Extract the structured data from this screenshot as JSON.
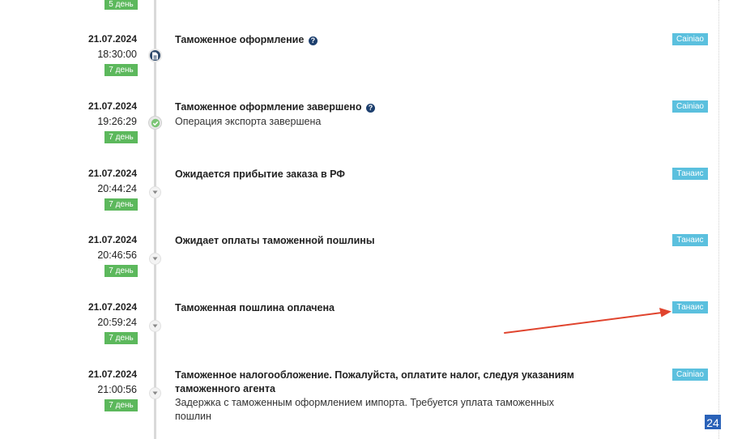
{
  "top_day_badge": "5 день",
  "events": [
    {
      "date": "21.07.2024",
      "time": "18:30:00",
      "day": "7 день",
      "title": "Таможенное оформление",
      "help": true,
      "desc": "",
      "source": "Cainiao",
      "marker": "document-icon"
    },
    {
      "date": "21.07.2024",
      "time": "19:26:29",
      "day": "7 день",
      "title": "Таможенное оформление завершено",
      "help": true,
      "desc": "Операция экспорта завершена",
      "source": "Cainiao",
      "marker": "check-icon"
    },
    {
      "date": "21.07.2024",
      "time": "20:44:24",
      "day": "7 день",
      "title": "Ожидается прибытие заказа в РФ",
      "help": false,
      "desc": "",
      "source": "Танаис",
      "marker": "chevron-down-icon"
    },
    {
      "date": "21.07.2024",
      "time": "20:46:56",
      "day": "7 день",
      "title": "Ожидает оплаты таможенной пошлины",
      "help": false,
      "desc": "",
      "source": "Танаис",
      "marker": "chevron-down-icon"
    },
    {
      "date": "21.07.2024",
      "time": "20:59:24",
      "day": "7 день",
      "title": "Таможенная пошлина оплачена",
      "help": false,
      "desc": "",
      "source": "Танаис",
      "marker": "chevron-down-icon"
    },
    {
      "date": "21.07.2024",
      "time": "21:00:56",
      "day": "7 день",
      "title": "Таможенное налогообложение. Пожалуйста, оплатите налог, следуя указаниям таможенного агента",
      "help": false,
      "desc": "Задержка с таможенным оформлением импорта. Требуется уплата таможенных пошлин",
      "source": "Cainiao",
      "marker": "chevron-down-icon"
    }
  ],
  "page_badge": "24",
  "colors": {
    "day_badge": "#5cb85c",
    "source_badge": "#5bc0de",
    "annotation_arrow": "#e0442e",
    "page_badge": "#2a62b8"
  }
}
